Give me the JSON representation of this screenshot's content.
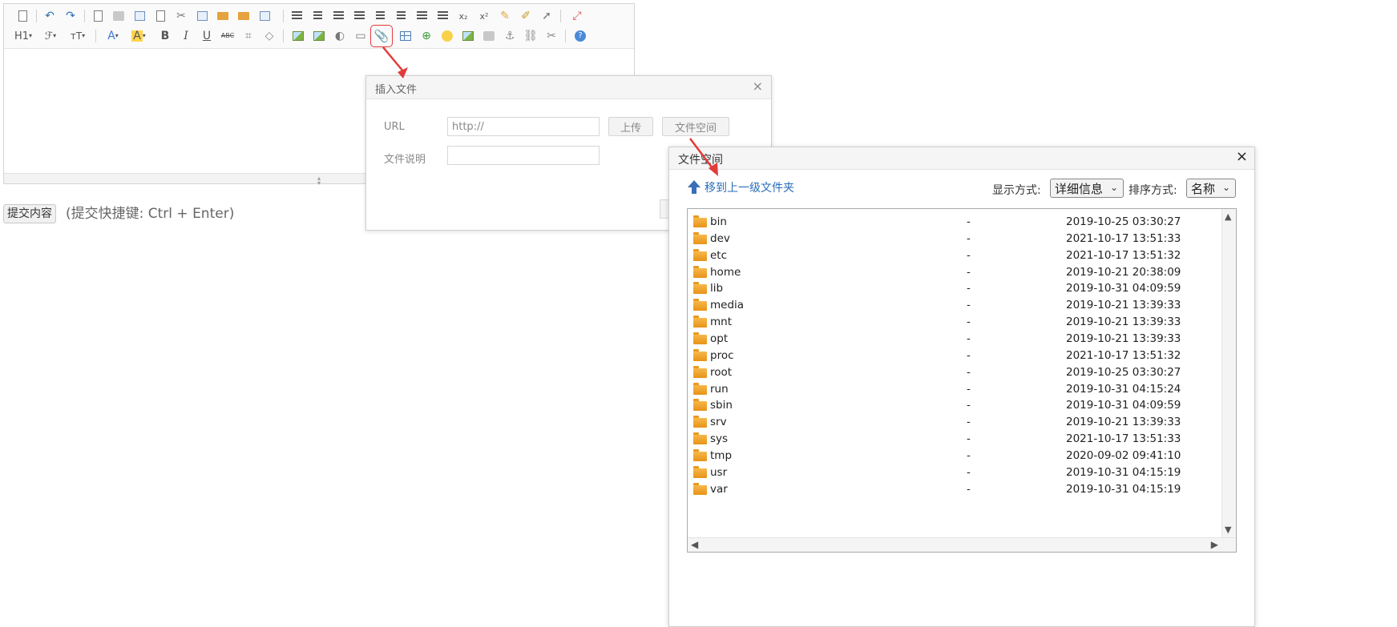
{
  "toolbar": {
    "heading_label": "H1",
    "font_label": "ℱ",
    "size_label": "тT",
    "font_color_label": "A",
    "bg_color_label": "A",
    "bold_label": "B",
    "italic_label": "I",
    "underline_label": "U",
    "strike_label": "ABC",
    "subscript_label": "x₂",
    "superscript_label": "x²",
    "help_label": "?"
  },
  "submit": {
    "button_label": "提交内容",
    "hint": "(提交快捷键: Ctrl + Enter)"
  },
  "insert_dialog": {
    "title": "插入文件",
    "close": "×",
    "url_label": "URL",
    "url_value": "http://",
    "upload_button": "上传",
    "file_space_button": "文件空间",
    "desc_label": "文件说明",
    "desc_value": ""
  },
  "file_dialog": {
    "title": "文件空间",
    "close": "×",
    "up_link": "移到上一级文件夹",
    "view_label": "显示方式:",
    "view_value": "详细信息",
    "sort_label": "排序方式:",
    "sort_value": "名称",
    "files": [
      {
        "name": "bin",
        "size": "-",
        "date": "2019-10-25 03:30:27"
      },
      {
        "name": "dev",
        "size": "-",
        "date": "2021-10-17 13:51:33"
      },
      {
        "name": "etc",
        "size": "-",
        "date": "2021-10-17 13:51:32"
      },
      {
        "name": "home",
        "size": "-",
        "date": "2019-10-21 20:38:09"
      },
      {
        "name": "lib",
        "size": "-",
        "date": "2019-10-31 04:09:59"
      },
      {
        "name": "media",
        "size": "-",
        "date": "2019-10-21 13:39:33"
      },
      {
        "name": "mnt",
        "size": "-",
        "date": "2019-10-21 13:39:33"
      },
      {
        "name": "opt",
        "size": "-",
        "date": "2019-10-21 13:39:33"
      },
      {
        "name": "proc",
        "size": "-",
        "date": "2021-10-17 13:51:32"
      },
      {
        "name": "root",
        "size": "-",
        "date": "2019-10-25 03:30:27"
      },
      {
        "name": "run",
        "size": "-",
        "date": "2019-10-31 04:15:24"
      },
      {
        "name": "sbin",
        "size": "-",
        "date": "2019-10-31 04:09:59"
      },
      {
        "name": "srv",
        "size": "-",
        "date": "2019-10-21 13:39:33"
      },
      {
        "name": "sys",
        "size": "-",
        "date": "2021-10-17 13:51:33"
      },
      {
        "name": "tmp",
        "size": "-",
        "date": "2020-09-02 09:41:10"
      },
      {
        "name": "usr",
        "size": "-",
        "date": "2019-10-31 04:15:19"
      },
      {
        "name": "var",
        "size": "-",
        "date": "2019-10-31 04:15:19"
      }
    ]
  },
  "colors": {
    "annotation": "#e23b3b",
    "link": "#2a6ebb",
    "folder": "#f0a830"
  }
}
